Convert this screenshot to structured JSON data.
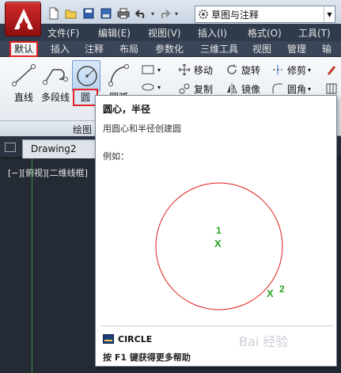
{
  "app": {
    "workspace": "草图与注释"
  },
  "menubar": {
    "items": [
      "文件(F)",
      "编辑(E)",
      "视图(V)",
      "插入(I)",
      "格式(O)",
      "工具(T)"
    ]
  },
  "ribbon_tabs": [
    "默认",
    "插入",
    "注释",
    "布局",
    "参数化",
    "三维工具",
    "视图",
    "管理",
    "输出"
  ],
  "ribbon": {
    "draw": {
      "line": "直线",
      "polyline": "多段线",
      "circle": "圆",
      "arc": "圆弧"
    },
    "modify": {
      "move": "移动",
      "rotate": "旋转",
      "trim": "修剪",
      "copy": "复制",
      "mirror": "镜像",
      "fillet": "圆角"
    },
    "panel_title": "绘图"
  },
  "drawing": {
    "tab": "Drawing2",
    "viewport_label": "[−][俯视][二维线框]"
  },
  "tooltip": {
    "title": "圆心，半径",
    "description": "用圆心和半径创建圆",
    "example_label": "例如：",
    "point1": "1",
    "point2": "2",
    "mark": "X",
    "command": "CIRCLE",
    "help": "按 F1 键获得更多帮助"
  },
  "colors": {
    "highlight_red": "#e52222",
    "circle_red": "#e01b1b",
    "point_green": "#2aa52a"
  },
  "watermark": "Bai 经验"
}
